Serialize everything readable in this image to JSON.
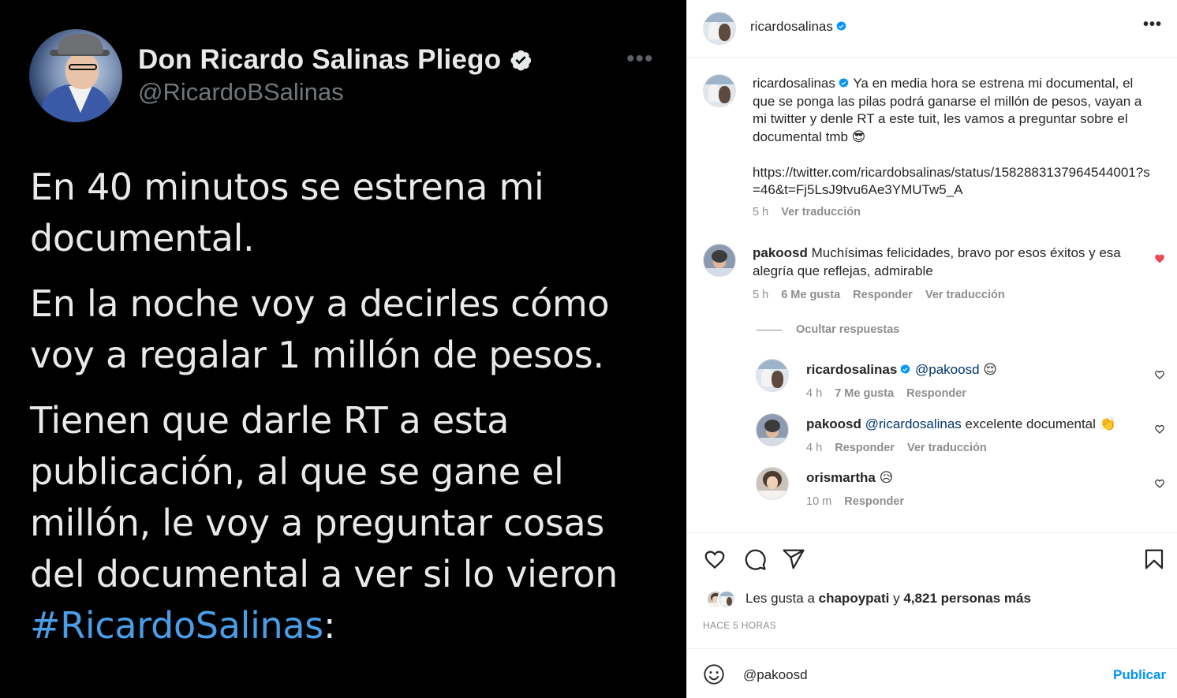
{
  "tweet": {
    "name": "Don Ricardo Salinas Pliego",
    "handle": "@RicardoBSalinas",
    "more": "•••",
    "paragraph1": "En 40 minutos se estrena mi documental.",
    "paragraph2": "En la noche voy a decirles cómo voy a regalar 1 millón de pesos.",
    "paragraph3": "Tienen que darle RT a esta publicación, al que se gane el millón, le voy a preguntar cosas del documental a ver si lo vieron",
    "hashtag": "#RicardoSalinas",
    "hashtag_suffix": ":",
    "colors": {
      "background": "#000000",
      "text": "#e7e9ea",
      "handle": "#71767b",
      "hashtag": "#4a9ee8"
    }
  },
  "post": {
    "header": {
      "username": "ricardosalinas",
      "more": "•••"
    },
    "caption": {
      "username": "ricardosalinas",
      "text": "Ya en media hora se estrena mi documental, el que se ponga las pilas podrá ganarse el millón de pesos, vayan a mi twitter y denle RT a este tuit, les vamos a preguntar sobre el documental tmb 😎",
      "link": "https://twitter.com/ricardobsalinas/status/1582883137964544001?s=46&t=Fj5LsJ9tvu6Ae3YMUTw5_A",
      "time": "5 h",
      "translate": "Ver traducción"
    },
    "comments": [
      {
        "username": "pakoosd",
        "text": "Muchísimas felicidades, bravo por esos éxitos y esa alegría que reflejas, admirable",
        "time": "5 h",
        "likes": "6 Me gusta",
        "reply": "Responder",
        "translate": "Ver traducción",
        "liked": true
      }
    ],
    "hide_replies": "Ocultar respuestas",
    "replies": [
      {
        "username": "ricardosalinas",
        "mention": "@pakoosd",
        "text": "😌",
        "time": "4 h",
        "likes": "7 Me gusta",
        "reply": "Responder"
      },
      {
        "username": "pakoosd",
        "mention": "@ricardosalinas",
        "text": "excelente documental 👏",
        "time": "4 h",
        "reply": "Responder",
        "translate": "Ver traducción"
      },
      {
        "username": "orismartha",
        "text": "😥",
        "time": "10 m",
        "reply": "Responder"
      }
    ],
    "likes": {
      "prefix": "Les gusta a",
      "user": "chapoypati",
      "mid": "y",
      "count": "4,821 personas más"
    },
    "posted_ago": "HACE 5 HORAS",
    "compose": {
      "value": "@pakoosd",
      "publish": "Publicar"
    },
    "colors": {
      "accent": "#0095f6",
      "verified": "#0095f6",
      "liked_heart": "#ed4956",
      "secondary_text": "#8e8e8e"
    }
  }
}
